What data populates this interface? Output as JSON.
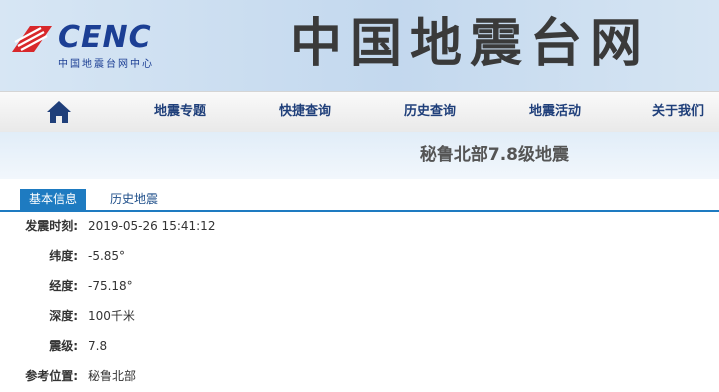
{
  "header": {
    "logo_text": "CENC",
    "logo_subtitle": "中国地震台网中心",
    "site_title": "中国地震台网"
  },
  "nav": {
    "home_icon": "home-icon",
    "items": [
      {
        "label": "地震专题"
      },
      {
        "label": "快捷查询"
      },
      {
        "label": "历史查询"
      },
      {
        "label": "地震活动"
      },
      {
        "label": "关于我们"
      }
    ]
  },
  "banner": {
    "title": "秘鲁北部7.8级地震"
  },
  "tabs": [
    {
      "label": "基本信息",
      "active": true
    },
    {
      "label": "历史地震",
      "active": false
    }
  ],
  "info": [
    {
      "label": "发震时刻:",
      "value": "2019-05-26 15:41:12"
    },
    {
      "label": "纬度:",
      "value": "-5.85°"
    },
    {
      "label": "经度:",
      "value": "-75.18°"
    },
    {
      "label": "深度:",
      "value": "100千米"
    },
    {
      "label": "震级:",
      "value": "7.8"
    },
    {
      "label": "参考位置:",
      "value": "秘鲁北部"
    }
  ],
  "colors": {
    "brand_blue": "#1c3f94",
    "brand_red": "#d8282b",
    "tab_blue": "#1e7bc1"
  }
}
